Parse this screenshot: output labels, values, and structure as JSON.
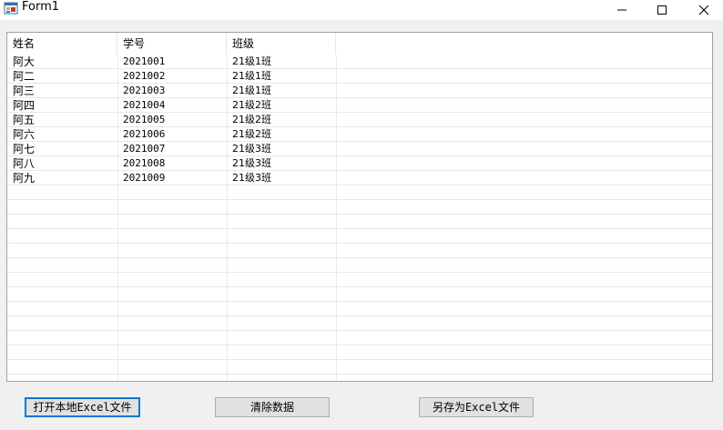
{
  "window": {
    "title": "Form1",
    "minimize_glyph": "—",
    "close_glyph": "✕"
  },
  "grid": {
    "columns": [
      "姓名",
      "学号",
      "班级"
    ],
    "rows": [
      [
        "阿大",
        "2021001",
        "21级1班"
      ],
      [
        "阿二",
        "2021002",
        "21级1班"
      ],
      [
        "阿三",
        "2021003",
        "21级1班"
      ],
      [
        "阿四",
        "2021004",
        "21级2班"
      ],
      [
        "阿五",
        "2021005",
        "21级2班"
      ],
      [
        "阿六",
        "2021006",
        "21级2班"
      ],
      [
        "阿七",
        "2021007",
        "21级3班"
      ],
      [
        "阿八",
        "2021008",
        "21级3班"
      ],
      [
        "阿九",
        "2021009",
        "21级3班"
      ]
    ]
  },
  "buttons": {
    "open_excel": "打开本地Excel文件",
    "clear_data": "清除数据",
    "save_as_excel": "另存为Excel文件"
  },
  "colors": {
    "focus_border": "#0078d7",
    "grid_border": "#a0a0a0",
    "background": "#f0f0f0"
  }
}
